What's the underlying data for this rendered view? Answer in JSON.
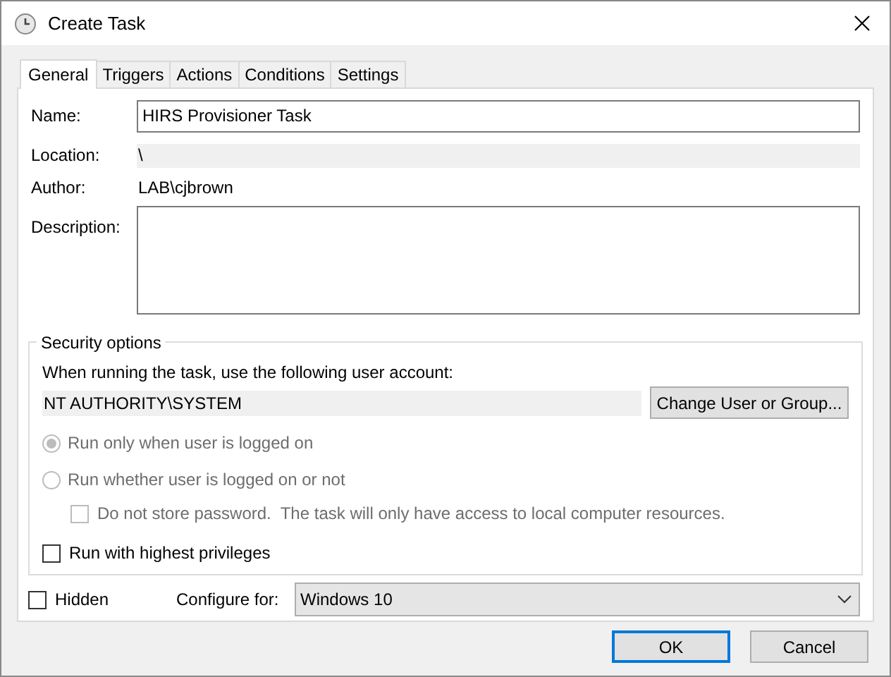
{
  "window": {
    "title": "Create Task"
  },
  "tabs": [
    {
      "label": "General",
      "selected": true
    },
    {
      "label": "Triggers",
      "selected": false
    },
    {
      "label": "Actions",
      "selected": false
    },
    {
      "label": "Conditions",
      "selected": false
    },
    {
      "label": "Settings",
      "selected": false
    }
  ],
  "name": {
    "label": "Name:",
    "value": "HIRS Provisioner Task"
  },
  "location": {
    "label": "Location:",
    "value": "\\"
  },
  "author": {
    "label": "Author:",
    "value": "LAB\\cjbrown"
  },
  "description": {
    "label": "Description:"
  },
  "security_options": {
    "title": "Security options",
    "prompt": "When running the task, use the following user account:",
    "account": "NT AUTHORITY\\SYSTEM",
    "change_button": "Change User or Group...",
    "run_options": [
      {
        "label": "Run only when user is logged on",
        "selected": true,
        "disabled": true
      },
      {
        "label": "Run whether user is logged on or not",
        "selected": false,
        "disabled": true
      }
    ],
    "do_not_store_password": {
      "label": "Do not store password.  The task will only have access to local computer resources.",
      "checked": false,
      "disabled": true
    },
    "highest_privileges": {
      "label": "Run with highest privileges",
      "checked": false,
      "disabled": false
    }
  },
  "hidden": {
    "label": "Hidden",
    "checked": false
  },
  "configure_for": {
    "label": "Configure for:",
    "value": "Windows 10"
  },
  "buttons": [
    {
      "label": "OK",
      "default": true
    },
    {
      "label": "Cancel",
      "default": false
    }
  ]
}
